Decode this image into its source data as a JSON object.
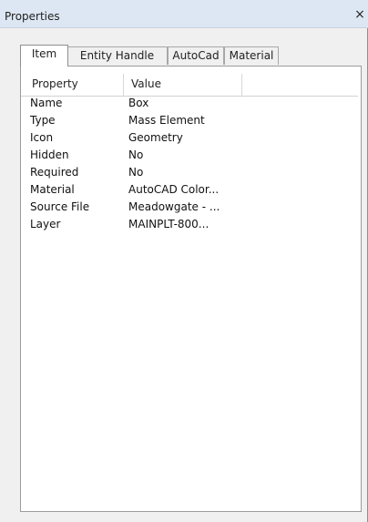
{
  "window": {
    "title": "Properties",
    "close_label": "×"
  },
  "tabs": [
    {
      "label": "Item",
      "active": true
    },
    {
      "label": "Entity Handle",
      "active": false
    },
    {
      "label": "AutoCad",
      "active": false
    },
    {
      "label": "Material",
      "active": false
    }
  ],
  "grid": {
    "headers": [
      "Property",
      "Value"
    ],
    "rows": [
      {
        "property": "Name",
        "value": "Box"
      },
      {
        "property": "Type",
        "value": "Mass Element"
      },
      {
        "property": "Icon",
        "value": "Geometry"
      },
      {
        "property": "Hidden",
        "value": "No"
      },
      {
        "property": "Required",
        "value": "No"
      },
      {
        "property": "Material",
        "value": "AutoCAD Color..."
      },
      {
        "property": "Source File",
        "value": "Meadowgate - ..."
      },
      {
        "property": "Layer",
        "value": "MAINPLT-800..."
      }
    ]
  }
}
